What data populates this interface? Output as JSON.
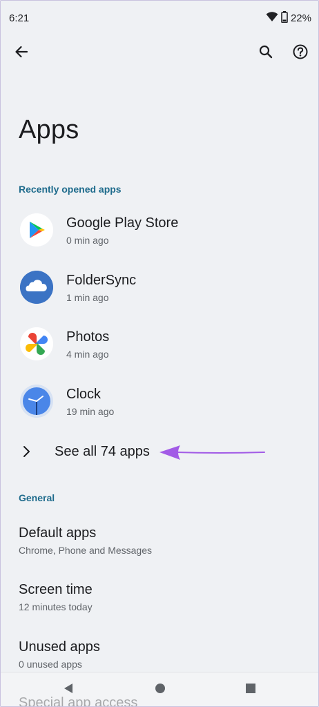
{
  "status": {
    "time": "6:21",
    "battery": "22%"
  },
  "header": {
    "title": "Apps",
    "back_icon": "arrow-left-icon",
    "search_icon": "search-icon",
    "help_icon": "help-icon"
  },
  "recent": {
    "header": "Recently opened apps",
    "apps": [
      {
        "name": "Google Play Store",
        "time": "0 min ago",
        "icon": "play-store-icon"
      },
      {
        "name": "FolderSync",
        "time": "1 min ago",
        "icon": "cloud-icon"
      },
      {
        "name": "Photos",
        "time": "4 min ago",
        "icon": "pinwheel-icon"
      },
      {
        "name": "Clock",
        "time": "19 min ago",
        "icon": "clock-icon"
      }
    ],
    "see_all": "See all 74 apps"
  },
  "general": {
    "header": "General",
    "items": [
      {
        "title": "Default apps",
        "subtitle": "Chrome, Phone and Messages"
      },
      {
        "title": "Screen time",
        "subtitle": "12 minutes today"
      },
      {
        "title": "Unused apps",
        "subtitle": "0 unused apps"
      }
    ],
    "partial_item": "Special app access"
  },
  "colors": {
    "accent": "#1e6b8c",
    "annotation_arrow": "#a25be6",
    "background": "#eff1f4"
  }
}
